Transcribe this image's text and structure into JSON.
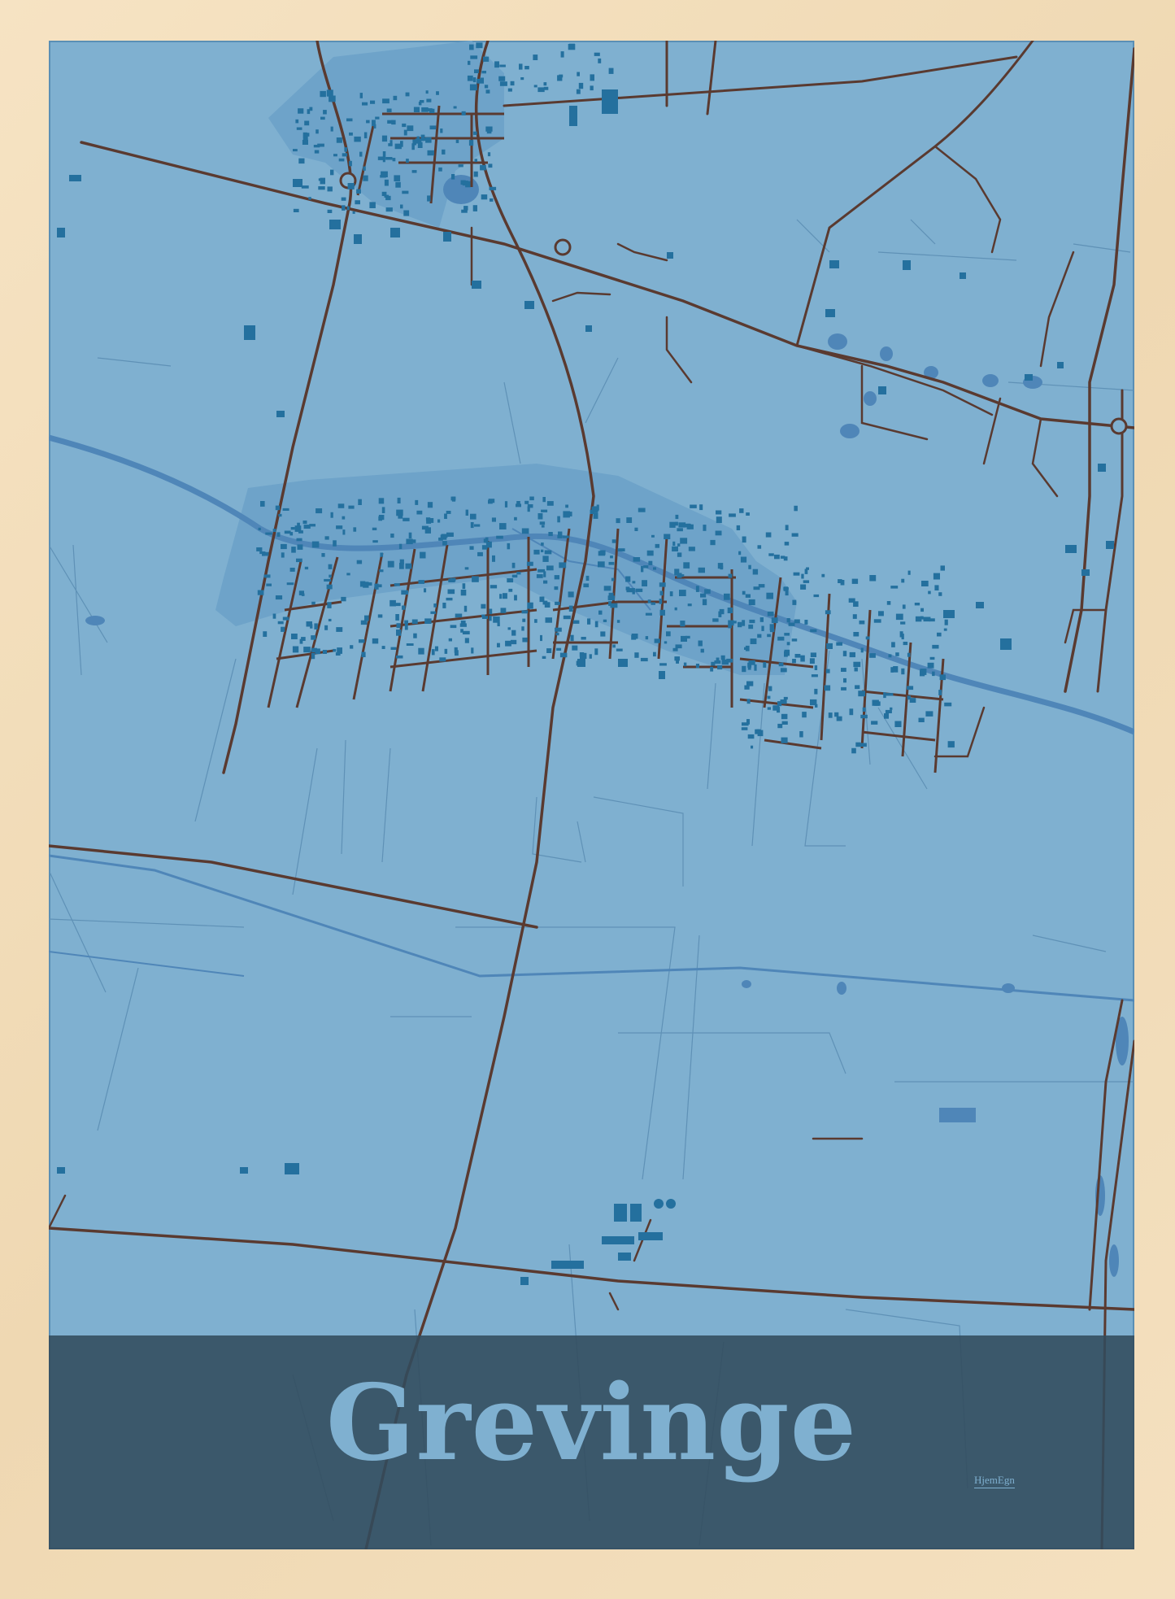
{
  "poster": {
    "place_name": "Grevinge",
    "brand": "HjemEgn"
  },
  "colors": {
    "frame": "#f3dfbd",
    "land": "#7fb0d0",
    "town_area": "#6ea3c9",
    "buildings": "#24709e",
    "roads": "#5a3a30",
    "waterway": "#4f86b8",
    "title_band": "#324b5c",
    "title_text": "#7fb0d0"
  }
}
